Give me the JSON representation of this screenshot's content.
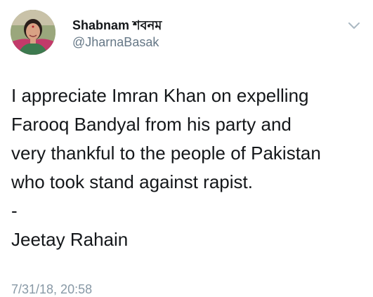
{
  "tweet": {
    "display_name": "Shabnam শবনম",
    "handle": "@JharnaBasak",
    "text": "I appreciate Imran Khan on expelling\nFarooq Bandyal from his party and\nvery thankful to the people of Pakistan\nwho took stand against rapist.\n-\nJeetay Rahain",
    "timestamp": "7/31/18, 20:58"
  },
  "icons": {
    "avatar": "profile-photo",
    "menu": "chevron-down-icon"
  },
  "colors": {
    "text": "#14171a",
    "secondary": "#657786",
    "caret": "#aab8c2"
  }
}
